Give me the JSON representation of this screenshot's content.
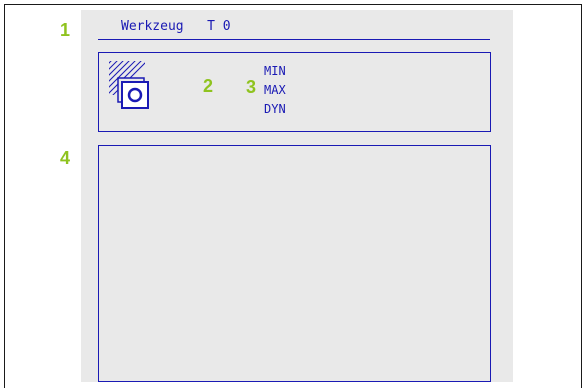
{
  "callouts": [
    "1",
    "2",
    "3",
    "4"
  ],
  "tool_panel": {
    "label": "Werkzeug",
    "tool_number": "T 0",
    "title_text": "Werkzeug   T 0"
  },
  "modes": [
    "MIN",
    "MAX",
    "DYN"
  ],
  "icons": {
    "tool_icon": "tool-holder-icon"
  },
  "colors": {
    "screen_blue": "#1a1ab4",
    "callout_green": "#8fc31f",
    "screen_bg": "#e9e9e9"
  }
}
